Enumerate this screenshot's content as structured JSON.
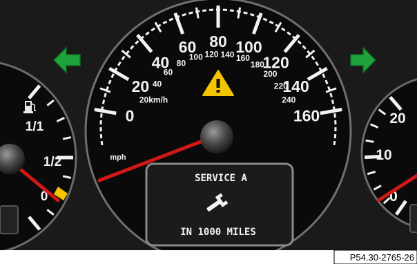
{
  "speedometer": {
    "mph_labels": [
      "0",
      "20",
      "40",
      "60",
      "80",
      "100",
      "120",
      "140",
      "160"
    ],
    "kmh_labels": [
      "20km/h",
      "40",
      "60",
      "80",
      "100",
      "120",
      "140",
      "160",
      "180",
      "200",
      "220",
      "240"
    ],
    "mph_unit": "mph",
    "needle_speed_mph": 0
  },
  "fuel_gauge": {
    "labels": [
      "1/1",
      "1/2",
      "0"
    ],
    "icon": "fuel-pump-icon",
    "level_fraction": 0.0
  },
  "right_gauge": {
    "labels": [
      "20",
      "10",
      "0"
    ],
    "needle_value": 0
  },
  "indicators": {
    "left_turn": {
      "icon": "left-turn-arrow-icon",
      "color": "#1ea33a"
    },
    "right_turn": {
      "icon": "right-turn-arrow-icon",
      "color": "#1ea33a"
    },
    "warning": {
      "icon": "warning-triangle-icon",
      "color": "#f5c400"
    }
  },
  "display": {
    "line1": "SERVICE A",
    "icon": "wrench-icon",
    "line2": "IN 1000 MILES"
  },
  "reference": "P54.30-2765-26",
  "colors": {
    "needle": "#d01818",
    "dial_face": "#0a0a0a",
    "bezel": "#2a2a2a",
    "fuel_reserve": "#f5c400"
  }
}
